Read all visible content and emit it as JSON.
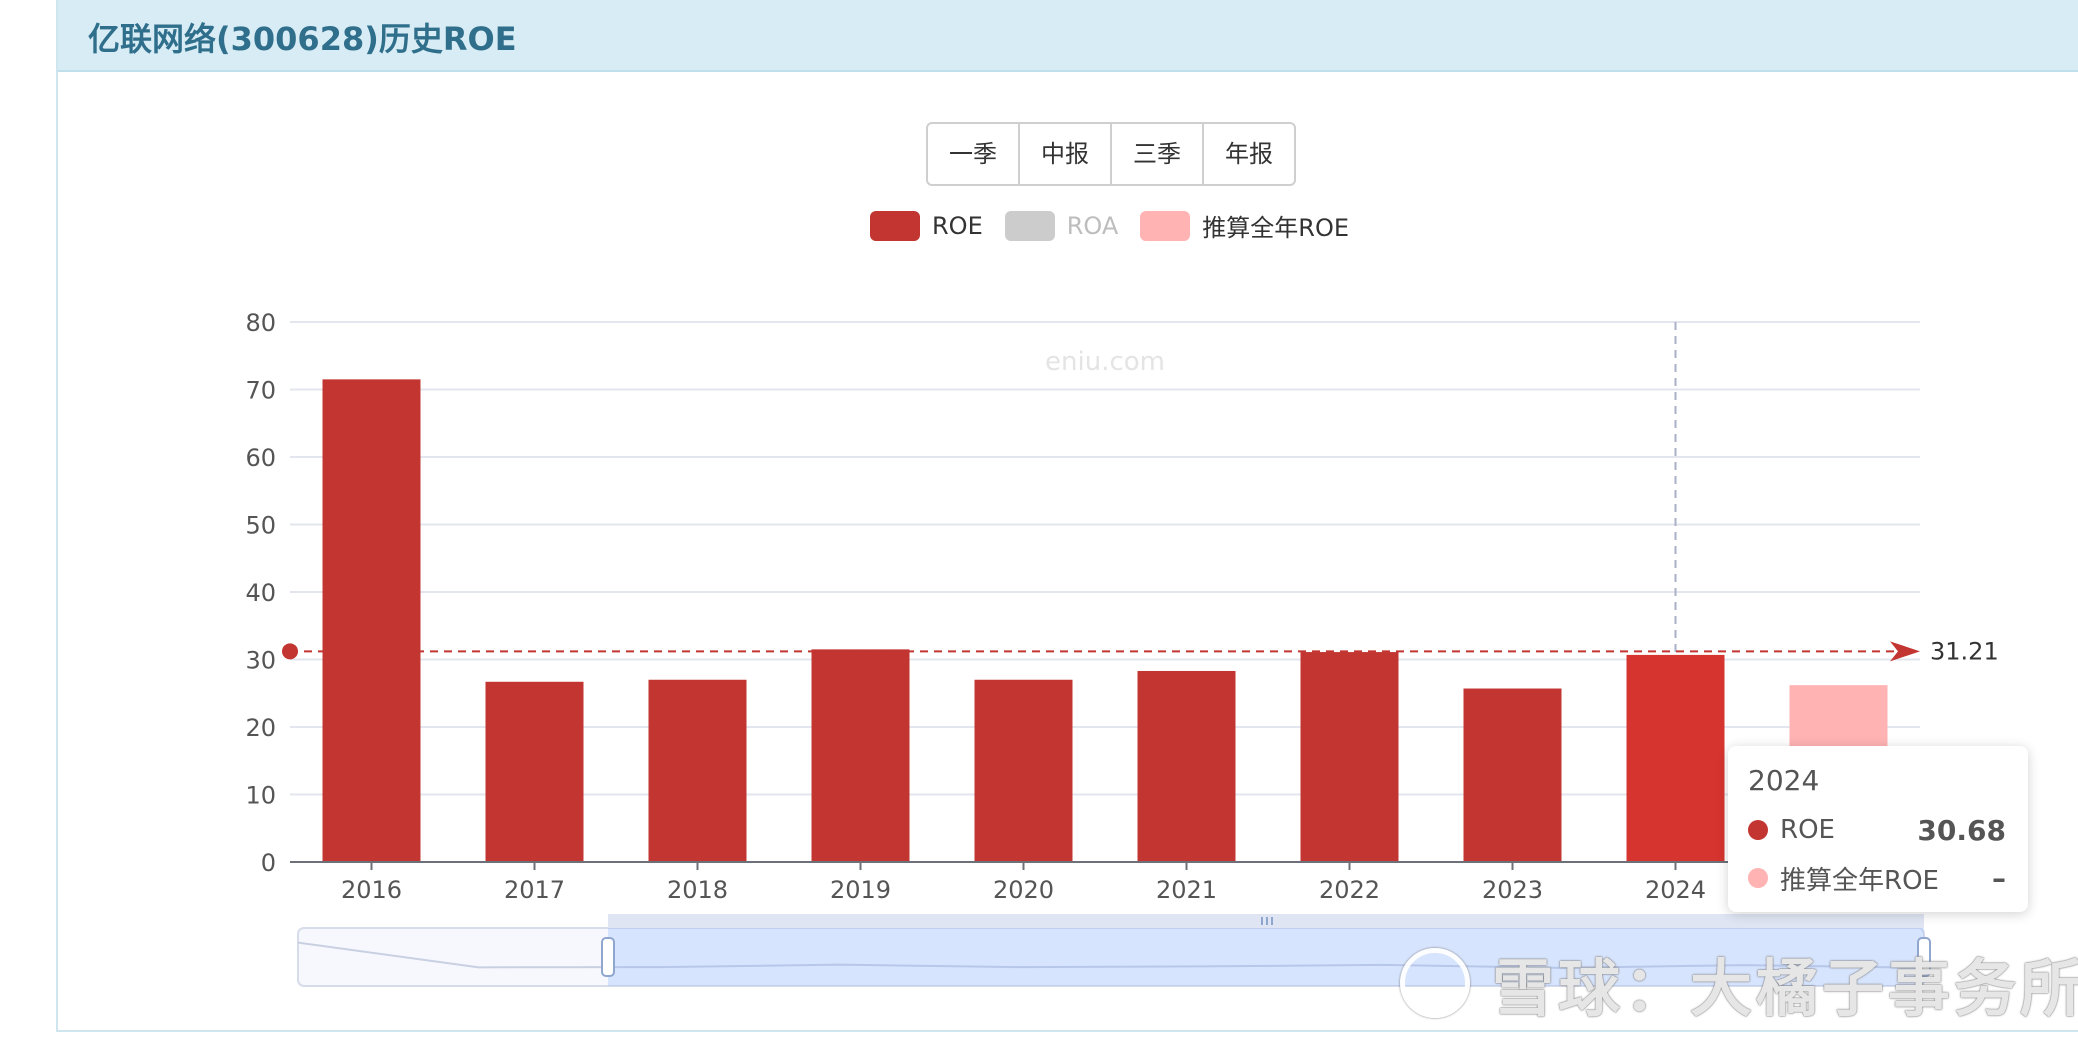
{
  "header": {
    "title": "亿联网络(300628)历史ROE"
  },
  "period_buttons": [
    "一季",
    "中报",
    "三季",
    "年报"
  ],
  "legend": [
    {
      "label": "ROE",
      "color": "#c23531",
      "active": true
    },
    {
      "label": "ROA",
      "color": "#cccccc",
      "active": false
    },
    {
      "label": "推算全年ROE",
      "color": "#ffb3b3",
      "active": true
    }
  ],
  "chart_watermark": "eniu.com",
  "chart_data": {
    "type": "bar",
    "categories": [
      "2016",
      "2017",
      "2018",
      "2019",
      "2020",
      "2021",
      "2022",
      "2023",
      "2024",
      "2025"
    ],
    "series": [
      {
        "name": "ROE",
        "values": [
          71.5,
          26.7,
          27.0,
          31.5,
          27.0,
          28.3,
          31.1,
          25.7,
          30.68,
          null
        ]
      },
      {
        "name": "推算全年ROE",
        "values": [
          null,
          null,
          null,
          null,
          null,
          null,
          null,
          null,
          null,
          26.2
        ]
      }
    ],
    "ylim": [
      0,
      80
    ],
    "yticks": [
      0,
      10,
      20,
      30,
      40,
      50,
      60,
      70,
      80
    ],
    "average_line": {
      "value": 31.21,
      "label": "31.21"
    },
    "grid": true,
    "highlight_category": "2024"
  },
  "tooltip": {
    "title": "2024",
    "rows": [
      {
        "name": "ROE",
        "value": "30.68",
        "color": "#c23531"
      },
      {
        "name": "推算全年ROE",
        "value": "–",
        "color": "#ffb3b3"
      }
    ]
  },
  "watermark": {
    "text": "雪球：大橘子事务所"
  }
}
